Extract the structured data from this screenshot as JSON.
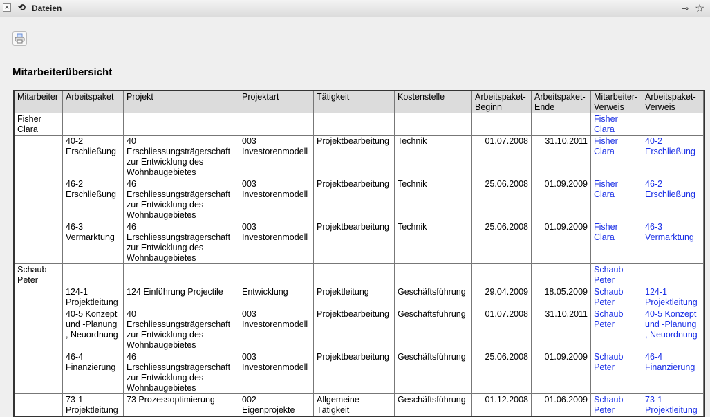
{
  "window": {
    "title": "Dateien"
  },
  "toolbar": {
    "print_icon": "printer-icon"
  },
  "page": {
    "heading": "Mitarbeiterübersicht"
  },
  "table": {
    "headers": [
      "Mitarbeiter",
      "Arbeitspaket",
      "Projekt",
      "Projektart",
      "Tätigkeit",
      "Kostenstelle",
      "Arbeitspaket-Beginn",
      "Arbeitspaket-Ende",
      "Mitarbeiter-Verweis",
      "Arbeitspaket-Verweis"
    ],
    "rows": [
      [
        "Fisher Clara",
        "",
        "",
        "",
        "",
        "",
        "",
        "",
        "Fisher Clara",
        ""
      ],
      [
        "",
        "40-2 Erschließung",
        "40 Erschliessungsträgerschaft zur Entwicklung des Wohnbaugebietes",
        "003 Investorenmodell",
        "Projektbearbeitung",
        "Technik",
        "01.07.2008",
        "31.10.2011",
        "Fisher Clara",
        "40-2 Erschließung"
      ],
      [
        "",
        "46-2 Erschließung",
        "46 Erschliessungsträgerschaft zur Entwicklung des Wohnbaugebietes",
        "003 Investorenmodell",
        "Projektbearbeitung",
        "Technik",
        "25.06.2008",
        "01.09.2009",
        "Fisher Clara",
        "46-2 Erschließung"
      ],
      [
        "",
        "46-3 Vermarktung",
        "46 Erschliessungsträgerschaft zur Entwicklung des Wohnbaugebietes",
        "003 Investorenmodell",
        "Projektbearbeitung",
        "Technik",
        "25.06.2008",
        "01.09.2009",
        "Fisher Clara",
        "46-3 Vermarktung"
      ],
      [
        "Schaub Peter",
        "",
        "",
        "",
        "",
        "",
        "",
        "",
        "Schaub Peter",
        ""
      ],
      [
        "",
        "124-1 Projektleitung",
        "124 Einführung Projectile",
        "Entwicklung",
        "Projektleitung",
        "Geschäftsführung",
        "29.04.2009",
        "18.05.2009",
        "Schaub Peter",
        "124-1 Projektleitung"
      ],
      [
        "",
        "40-5 Konzept und -Planung , Neuordnung",
        "40 Erschliessungsträgerschaft zur Entwicklung des Wohnbaugebietes",
        "003 Investorenmodell",
        "Projektbearbeitung",
        "Geschäftsführung",
        "01.07.2008",
        "31.10.2011",
        "Schaub Peter",
        "40-5 Konzept und -Planung , Neuordnung"
      ],
      [
        "",
        "46-4 Finanzierung",
        "46 Erschliessungsträgerschaft zur Entwicklung des Wohnbaugebietes",
        "003 Investorenmodell",
        "Projektbearbeitung",
        "Geschäftsführung",
        "25.06.2008",
        "01.09.2009",
        "Schaub Peter",
        "46-4 Finanzierung"
      ],
      [
        "",
        "73-1 Projektleitung",
        "73 Prozessoptimierung",
        "002 Eigenprojekte",
        "Allgemeine Tätigkeit",
        "Geschäftsführung",
        "01.12.2008",
        "01.06.2009",
        "Schaub Peter",
        "73-1 Projektleitung"
      ]
    ]
  }
}
